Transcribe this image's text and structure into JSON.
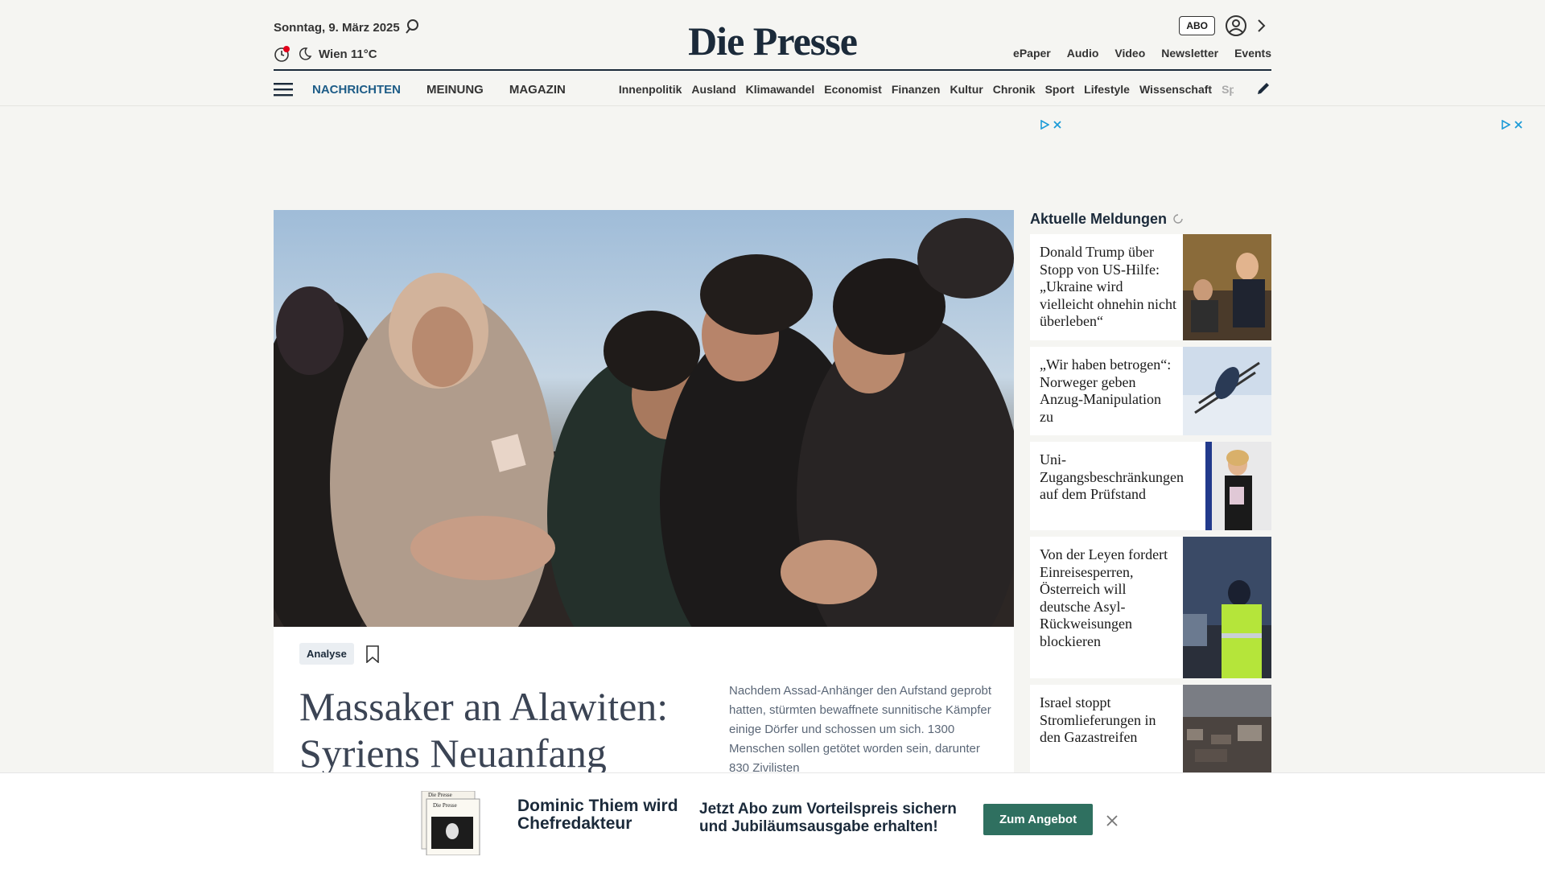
{
  "header": {
    "date": "Sonntag, 9. März 2025",
    "weather": "Wien 11°C",
    "brand": "Die Presse",
    "abo_label": "ABO",
    "top_links": [
      "ePaper",
      "Audio",
      "Video",
      "Newsletter",
      "Events"
    ]
  },
  "nav": {
    "main": [
      "NACHRICHTEN",
      "MEINUNG",
      "MAGAZIN"
    ],
    "active": "NACHRICHTEN",
    "sections": [
      "Innenpolitik",
      "Ausland",
      "Klimawandel",
      "Economist",
      "Finanzen",
      "Kultur",
      "Chronik",
      "Sport",
      "Lifestyle",
      "Wissenschaft",
      "Spectrum"
    ]
  },
  "hero": {
    "tag": "Analyse",
    "headline": "Massaker an Alawiten: Syriens Neuanfang",
    "teaser": "Nachdem Assad-Anhänger den Aufstand geprobt hatten, stürmten bewaffnete sunnitische Kämpfer einige Dörfer und schossen um sich. 1300 Menschen sollen getötet worden sein, darunter 830 Zivilisten"
  },
  "sidebar": {
    "title": "Aktuelle Meldungen",
    "items": [
      {
        "text": "Donald Trump über Stopp von US-Hilfe: „Ukraine wird vielleicht ohnehin nicht überleben“"
      },
      {
        "text": "„Wir haben betrogen“: Norweger geben Anzug-Manipulation zu"
      },
      {
        "text": "Uni-Zugangsbeschränkungen auf dem Prüfstand"
      },
      {
        "text": "Von der Leyen fordert Einreisesperren, Österreich will deutsche Asyl-Rückweisungen blockieren"
      },
      {
        "text": "Israel stoppt Stromlieferungen in den Gazastreifen"
      }
    ]
  },
  "banner": {
    "headline": "Dominic Thiem wird Chefredakteur",
    "cover_brand": "Die Presse",
    "offer": "Jetzt Abo zum Vorteilspreis sichern und Jubiläumsausgabe erhalten!",
    "button": "Zum Angebot"
  },
  "colors": {
    "brand_navy": "#1b2a3a",
    "nav_active": "#1d5c87",
    "cta_green": "#2f7060",
    "ad_blue": "#1d9bd7",
    "weather_dot": "#e2001a"
  }
}
